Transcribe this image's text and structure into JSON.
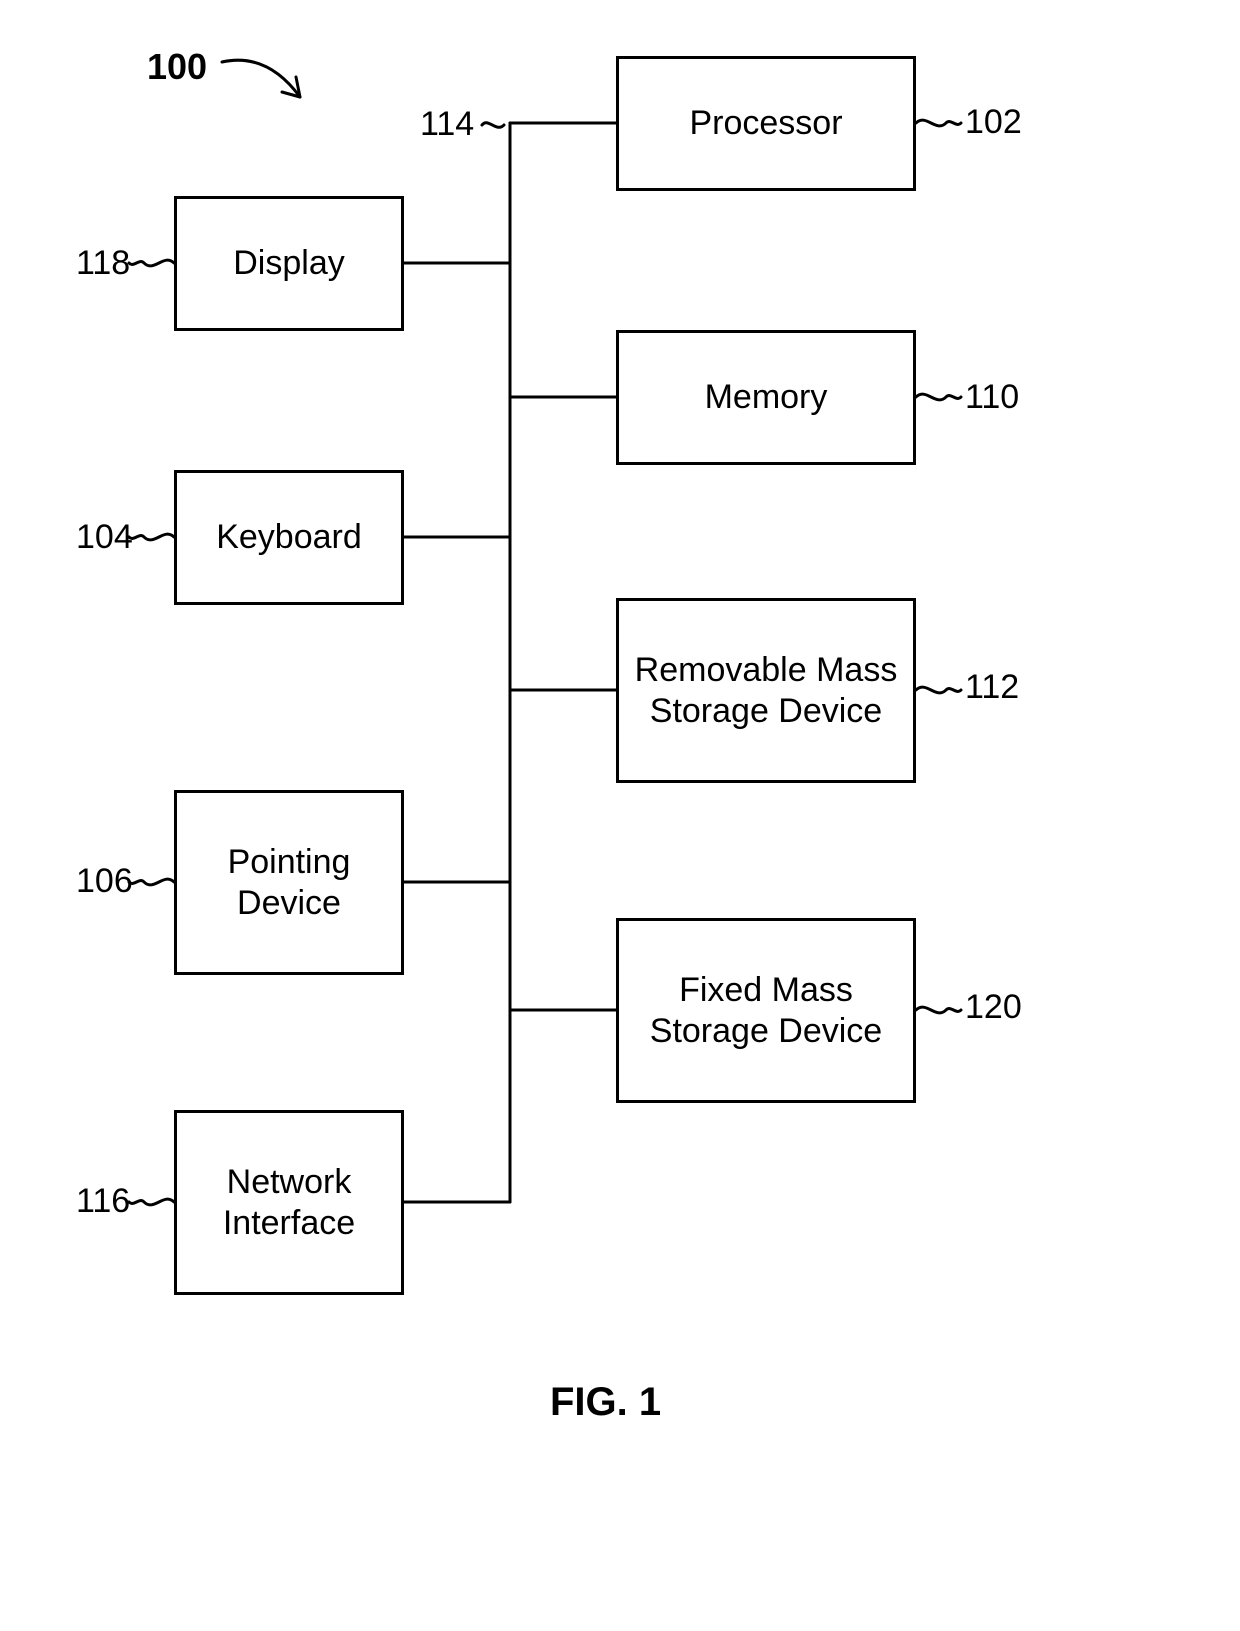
{
  "figure_ref": "100",
  "caption": "FIG. 1",
  "bus_ref": "114",
  "blocks": {
    "processor": {
      "label": "Processor",
      "ref": "102"
    },
    "display": {
      "label": "Display",
      "ref": "118"
    },
    "memory": {
      "label": "Memory",
      "ref": "110"
    },
    "keyboard": {
      "label": "Keyboard",
      "ref": "104"
    },
    "removable": {
      "label": "Removable Mass Storage Device",
      "ref": "112"
    },
    "pointing": {
      "label": "Pointing Device",
      "ref": "106"
    },
    "fixedms": {
      "label": "Fixed Mass Storage Device",
      "ref": "120"
    },
    "network": {
      "label": "Network Interface",
      "ref": "116"
    }
  },
  "chart_data": {
    "type": "block-diagram",
    "title": "FIG. 1",
    "system_ref": "100",
    "bus_ref": "114",
    "nodes": [
      {
        "id": "processor",
        "label": "Processor",
        "ref": "102",
        "side": "right"
      },
      {
        "id": "memory",
        "label": "Memory",
        "ref": "110",
        "side": "right"
      },
      {
        "id": "removable",
        "label": "Removable Mass Storage Device",
        "ref": "112",
        "side": "right"
      },
      {
        "id": "fixedms",
        "label": "Fixed Mass Storage Device",
        "ref": "120",
        "side": "right"
      },
      {
        "id": "display",
        "label": "Display",
        "ref": "118",
        "side": "left"
      },
      {
        "id": "keyboard",
        "label": "Keyboard",
        "ref": "104",
        "side": "left"
      },
      {
        "id": "pointing",
        "label": "Pointing Device",
        "ref": "106",
        "side": "left"
      },
      {
        "id": "network",
        "label": "Network Interface",
        "ref": "116",
        "side": "left"
      }
    ],
    "edges": [
      {
        "from": "bus",
        "to": "processor"
      },
      {
        "from": "bus",
        "to": "memory"
      },
      {
        "from": "bus",
        "to": "removable"
      },
      {
        "from": "bus",
        "to": "fixedms"
      },
      {
        "from": "bus",
        "to": "display"
      },
      {
        "from": "bus",
        "to": "keyboard"
      },
      {
        "from": "bus",
        "to": "pointing"
      },
      {
        "from": "bus",
        "to": "network"
      }
    ]
  }
}
